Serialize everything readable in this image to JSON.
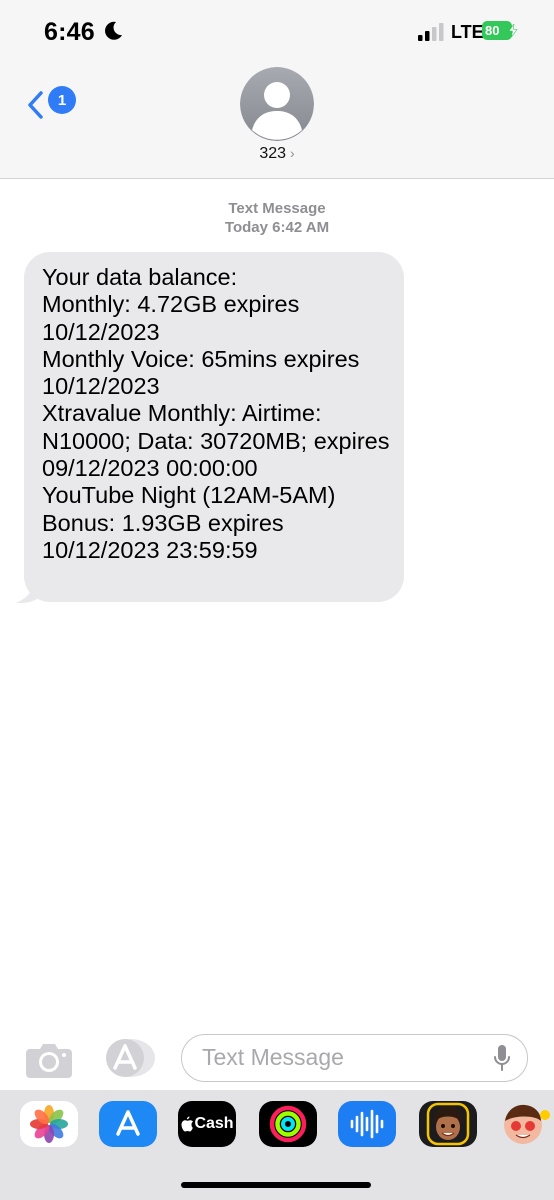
{
  "status_bar": {
    "time": "6:46",
    "network": "LTE",
    "battery": "80"
  },
  "nav": {
    "back_badge": "1",
    "contact_name": "323",
    "contact_chevron": "›"
  },
  "conversation": {
    "service": "Text Message",
    "timestamp": "Today 6:42 AM",
    "messages": [
      {
        "text": "Your data balance:\nMonthly: 4.72GB expires 10/12/2023\nMonthly Voice: 65mins expires 10/12/2023\nXtravalue Monthly: Airtime: N10000; Data: 30720MB; expires 09/12/2023 00:00:00\nYouTube Night (12AM-5AM) Bonus: 1.93GB expires 10/12/2023 23:59:59"
      }
    ]
  },
  "composer": {
    "placeholder": "Text Message"
  },
  "app_drawer": {
    "apps": [
      {
        "name": "photos",
        "icon": "photos-icon"
      },
      {
        "name": "app-store",
        "icon": "app-store-icon"
      },
      {
        "name": "apple-cash",
        "icon": "apple-cash-icon",
        "label": "Cash"
      },
      {
        "name": "activity",
        "icon": "activity-icon"
      },
      {
        "name": "audio-message",
        "icon": "waveform-icon"
      },
      {
        "name": "memoji",
        "icon": "memoji-icon"
      },
      {
        "name": "memoji-stickers",
        "icon": "memoji-stickers-icon"
      }
    ]
  },
  "colors": {
    "accent": "#2f7cf6",
    "bubble": "#e9e9eb",
    "battery": "#34c759"
  }
}
